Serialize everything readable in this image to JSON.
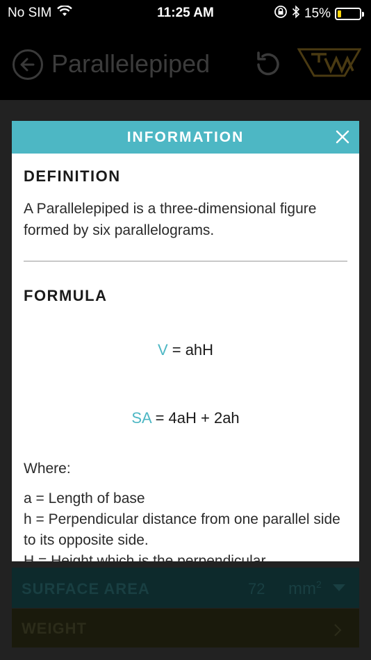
{
  "status_bar": {
    "carrier": "No SIM",
    "time": "11:25 AM",
    "battery_percent": "15%"
  },
  "header": {
    "title": "Parallelepiped"
  },
  "modal": {
    "title": "INFORMATION",
    "definition_heading": "DEFINITION",
    "definition_text": "A Parallelepiped is a three-dimensional figure formed by six parallelograms.",
    "formula_heading": "FORMULA",
    "formula_volume_var": "V",
    "formula_volume_expr": " = ahH",
    "formula_sa_var": "SA",
    "formula_sa_expr": " = 4aH + 2ah",
    "where_label": "Where:",
    "def_a": "a = Length of base",
    "def_h": "h = Perpendicular distance from one parallel side to its opposite side.",
    "def_H": "H = Height which is the perpendicular"
  },
  "results": {
    "surface_area_label": "SURFACE AREA",
    "surface_area_value": "72",
    "surface_area_unit": "mm",
    "surface_area_unit_exp": "2",
    "weight_label": "WEIGHT"
  },
  "colors": {
    "accent": "#4db7c4",
    "brand_gold": "#8a6a1f"
  },
  "icons": [
    "wifi-icon",
    "lock-rotation-icon",
    "bluetooth-icon",
    "battery-icon",
    "back-icon",
    "reset-icon",
    "logo-icon",
    "close-icon",
    "dropdown-icon",
    "chevron-right-icon"
  ]
}
